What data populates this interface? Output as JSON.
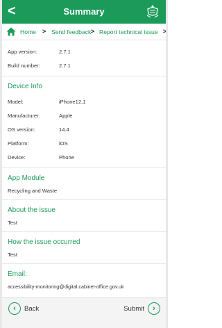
{
  "header": {
    "back_glyph": "<",
    "title": "Summary",
    "logo_icon": "royal-arms-icon"
  },
  "breadcrumb": {
    "home_icon": "home-icon",
    "items": [
      "Home",
      "Send feedback",
      "Report technical issue"
    ],
    "separator": ">"
  },
  "app_info": [
    {
      "label": "App version:",
      "value": "2.7.1"
    },
    {
      "label": "Build number:",
      "value": "2.7.1"
    }
  ],
  "device_info": {
    "title": "Device Info",
    "rows": [
      {
        "label": "Model:",
        "value": "iPhone12,1"
      },
      {
        "label": "Manufacturer:",
        "value": "Apple"
      },
      {
        "label": "OS version:",
        "value": "14.4"
      },
      {
        "label": "Platform:",
        "value": "iOS"
      },
      {
        "label": "Device:",
        "value": "Phone"
      }
    ]
  },
  "app_module": {
    "title": "App Module",
    "value": "Recycling and Waste"
  },
  "about_issue": {
    "title": "About the issue",
    "value": "Test"
  },
  "how_occurred": {
    "title": "How the issue occurred",
    "value": "Test"
  },
  "email": {
    "title": "Email:",
    "value": "accessibility-monitoring@digital.cabinet-office.gov.uk"
  },
  "footer": {
    "back_label": "Back",
    "submit_label": "Submit",
    "back_icon": "chevron-left-circle-icon",
    "submit_icon": "chevron-right-circle-icon"
  },
  "colors": {
    "accent": "#1b9a5a"
  }
}
